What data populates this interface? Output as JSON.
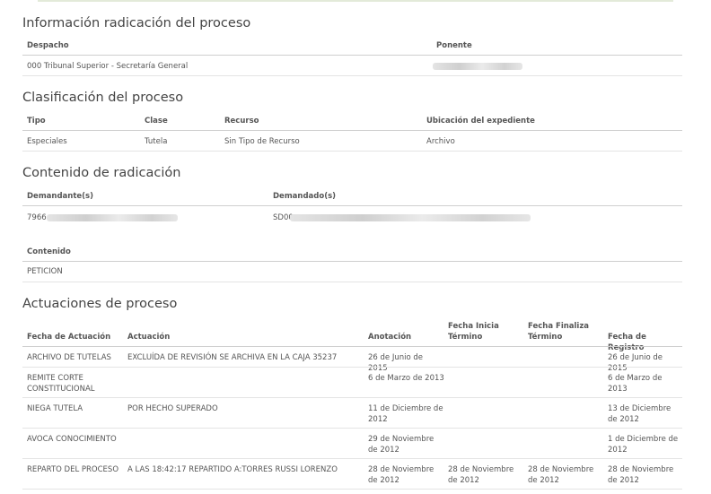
{
  "radicacion": {
    "title": "Información radicación del proceso",
    "despacho_label": "Despacho",
    "ponente_label": "Ponente",
    "despacho_value": "000 Tribunal Superior - Secretaría General"
  },
  "clasificacion": {
    "title": "Clasificación del proceso",
    "tipo_label": "Tipo",
    "clase_label": "Clase",
    "recurso_label": "Recurso",
    "ubicacion_label": "Ubicación del expediente",
    "tipo_value": "Especiales",
    "clase_value": "Tutela",
    "recurso_value": "Sin Tipo de Recurso",
    "ubicacion_value": "Archivo"
  },
  "contenido": {
    "title": "Contenido de radicación",
    "demandante_label": "Demandante(s)",
    "demandado_label": "Demandado(s)",
    "demandante_prefix": "7966",
    "demandado_prefix": "SD00",
    "contenido_label": "Contenido",
    "contenido_value": "PETICION"
  },
  "actuaciones": {
    "title": "Actuaciones de proceso",
    "headers": [
      "Fecha de Actuación",
      "Actuación",
      "Anotación",
      "Fecha Inicia Término",
      "Fecha Finaliza Término",
      "Fecha de Registro"
    ],
    "rows": [
      [
        "ARCHIVO DE TUTELAS",
        "EXCLUÍDA DE REVISIÓN SE ARCHIVA EN LA CAJA 35237",
        "26 de Junio de 2015",
        "",
        "",
        "26 de Junio de 2015"
      ],
      [
        "REMITE CORTE CONSTITUCIONAL",
        "",
        "6 de Marzo de 2013",
        "",
        "",
        "6 de Marzo de 2013"
      ],
      [
        "NIEGA TUTELA",
        "POR HECHO SUPERADO",
        "11 de Diciembre de 2012",
        "",
        "",
        "13 de Diciembre de 2012"
      ],
      [
        "AVOCA CONOCIMIENTO",
        "",
        "29 de Noviembre de 2012",
        "",
        "",
        "1 de Diciembre de 2012"
      ],
      [
        "REPARTO DEL PROCESO",
        "A LAS 18:42:17 REPARTIDO A:TORRES RUSSI LORENZO",
        "28 de Noviembre de 2012",
        "28 de Noviembre de 2012",
        "28 de Noviembre de 2012",
        "28 de Noviembre de 2012"
      ]
    ]
  }
}
